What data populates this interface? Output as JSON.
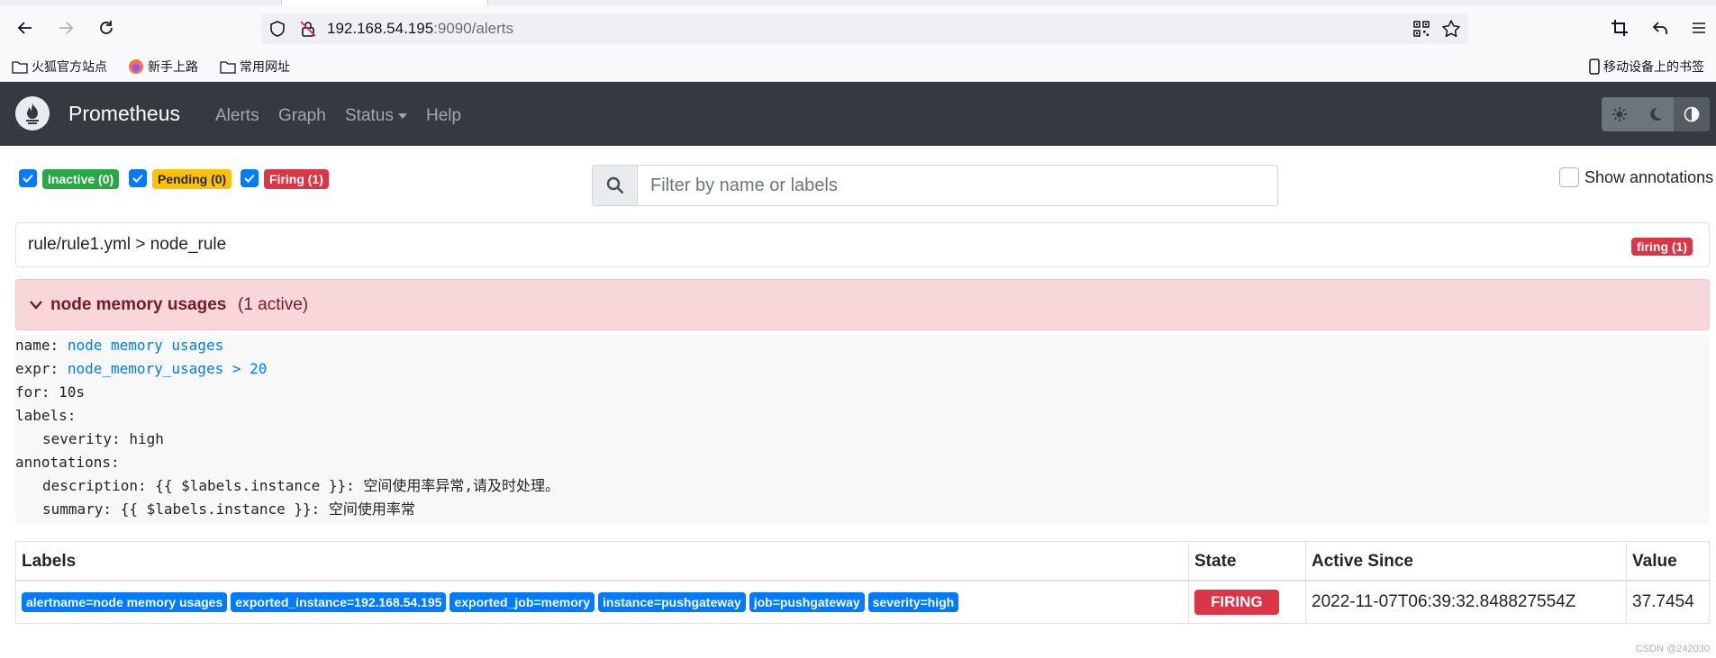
{
  "browser": {
    "url_host": "192.168.54.195",
    "url_path": ":9090/alerts",
    "bookmarks": [
      "火狐官方站点",
      "新手上路",
      "常用网址"
    ],
    "mobile_bookmarks": "移动设备上的书签"
  },
  "navbar": {
    "brand": "Prometheus",
    "items": [
      "Alerts",
      "Graph",
      "Status",
      "Help"
    ]
  },
  "filters": {
    "inactive": "Inactive (0)",
    "pending": "Pending (0)",
    "firing": "Firing (1)",
    "search_placeholder": "Filter by name or labels",
    "show_annotations": "Show annotations"
  },
  "group": {
    "title": "rule/rule1.yml > node_rule",
    "badge": "firing (1)"
  },
  "alert": {
    "name": "node memory usages",
    "active_count": "(1 active)"
  },
  "rule": {
    "name_key": "name:",
    "name_val": "node memory usages",
    "expr_key": "expr:",
    "expr_val": "node_memory_usages > 20",
    "for_line": "for: 10s",
    "labels_key": "labels:",
    "severity_line": "severity: high",
    "annotations_key": "annotations:",
    "description_line": "description: {{ $labels.instance }}: 空间使用率异常,请及时处理。",
    "summary_line": "summary: {{ $labels.instance }}: 空间使用率常"
  },
  "table": {
    "headers": [
      "Labels",
      "State",
      "Active Since",
      "Value"
    ],
    "row": {
      "labels": [
        "alertname=node memory usages",
        "exported_instance=192.168.54.195",
        "exported_job=memory",
        "instance=pushgateway",
        "job=pushgateway",
        "severity=high"
      ],
      "state": "FIRING",
      "active_since": "2022-11-07T06:39:32.848827554Z",
      "value": "37.7454"
    }
  },
  "watermark": "CSDN @242030"
}
